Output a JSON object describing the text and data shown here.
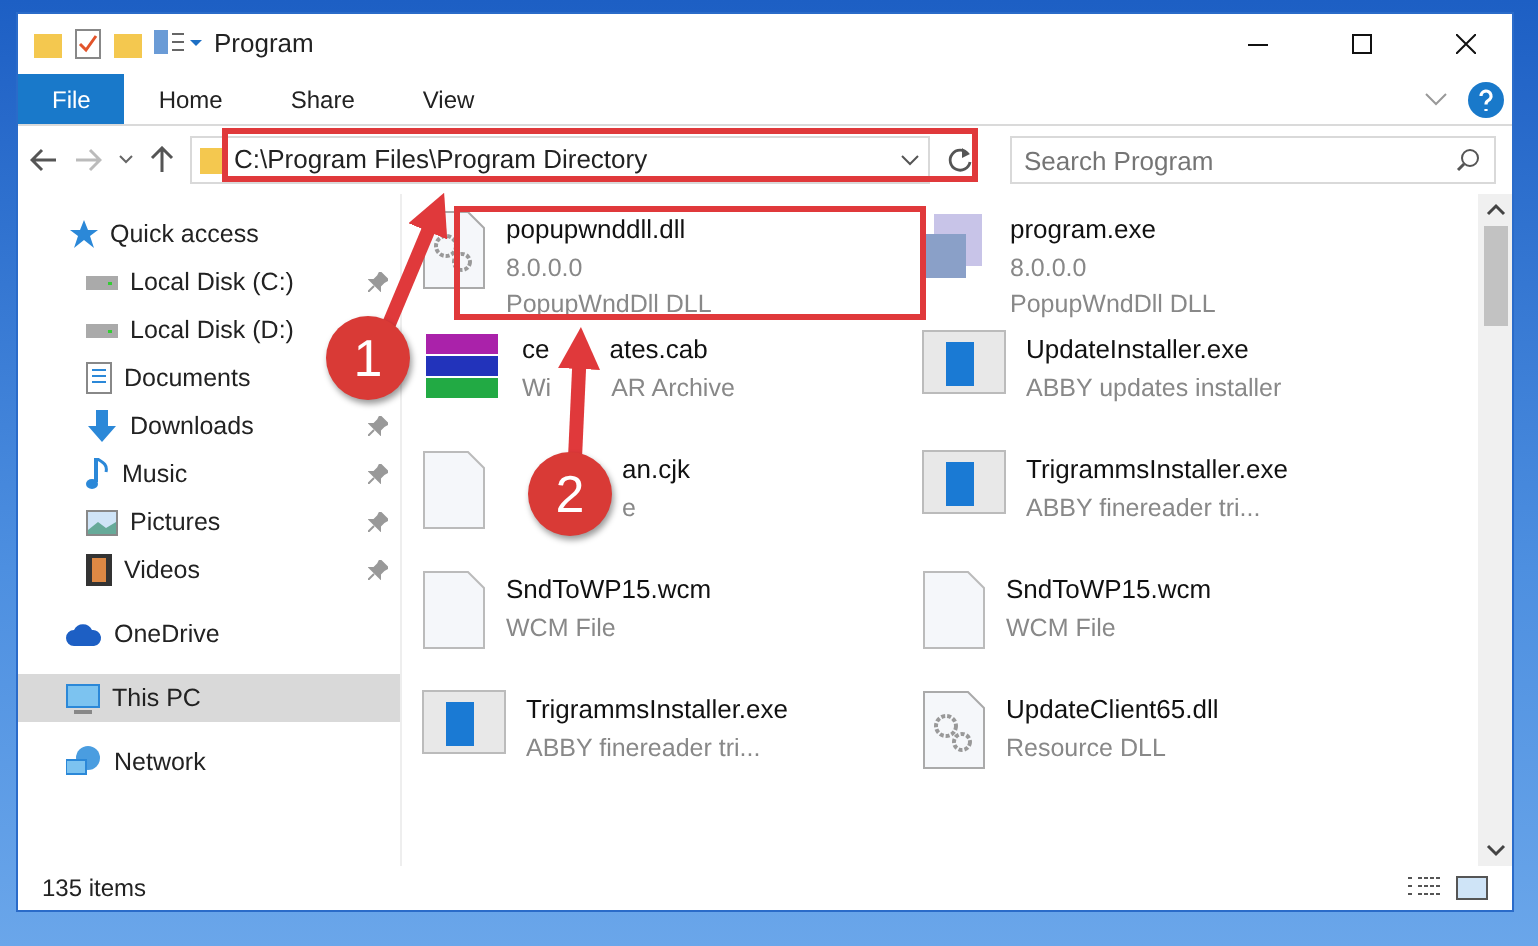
{
  "window": {
    "title": "Program"
  },
  "ribbon_tabs": [
    {
      "label": "File",
      "selected": true
    },
    {
      "label": "Home",
      "selected": false
    },
    {
      "label": "Share",
      "selected": false
    },
    {
      "label": "View",
      "selected": false
    }
  ],
  "address": {
    "path": "C:\\Program Files\\Program Directory"
  },
  "search": {
    "placeholder": "Search Program"
  },
  "sidebar": {
    "items": [
      {
        "label": "Quick access",
        "selected": false,
        "pinned": false,
        "children": [
          {
            "label": "Local Disk (C:)",
            "pinned": true,
            "selected": false
          },
          {
            "label": "Local Disk (D:)",
            "pinned": false,
            "selected": false
          },
          {
            "label": "Documents",
            "pinned": false,
            "selected": false
          },
          {
            "label": "Downloads",
            "pinned": true,
            "selected": false
          },
          {
            "label": "Music",
            "pinned": true,
            "selected": false
          },
          {
            "label": "Pictures",
            "pinned": true,
            "selected": false
          },
          {
            "label": "Videos",
            "pinned": true,
            "selected": false
          }
        ]
      },
      {
        "label": "OneDrive",
        "pinned": false,
        "selected": false
      },
      {
        "label": "This PC",
        "pinned": false,
        "selected": true
      },
      {
        "label": "Network",
        "pinned": false,
        "selected": false
      }
    ]
  },
  "files": [
    {
      "name": [
        "popupwnddll.dll"
      ],
      "lines": [
        [
          "8.0.0.0"
        ],
        [
          "PopupWndDll DLL"
        ]
      ]
    },
    {
      "name": [
        "program.exe"
      ],
      "lines": [
        [
          "8.0.0.0"
        ],
        [
          "PopupWndDll DLL"
        ]
      ]
    },
    {
      "name": [
        "ce",
        "ates.cab"
      ],
      "lines": [
        [
          "Wi",
          "AR Archive"
        ]
      ]
    },
    {
      "name": [
        "UpdateInstaller.exe"
      ],
      "lines": [
        [
          "ABBY updates installer"
        ]
      ]
    },
    {
      "name": [
        "an.cjk"
      ],
      "lines": [
        [
          "e"
        ]
      ]
    },
    {
      "name": [
        "TrigrammsInstaller.exe"
      ],
      "lines": [
        [
          "ABBY finereader tri..."
        ]
      ]
    },
    {
      "name": [
        "SndToWP15.wcm"
      ],
      "lines": [
        [
          "WCM File"
        ]
      ]
    },
    {
      "name": [
        "SndToWP15.wcm"
      ],
      "lines": [
        [
          "WCM File"
        ]
      ]
    },
    {
      "name": [
        "TrigrammsInstaller.exe"
      ],
      "lines": [
        [
          "ABBY finereader tri..."
        ]
      ]
    },
    {
      "name": [
        "UpdateClient65.dll"
      ],
      "lines": [
        [
          "Resource DLL"
        ]
      ]
    }
  ],
  "status_bar": {
    "count": "135 items"
  },
  "annotations": [
    {
      "label": "1"
    },
    {
      "label": "2"
    }
  ]
}
